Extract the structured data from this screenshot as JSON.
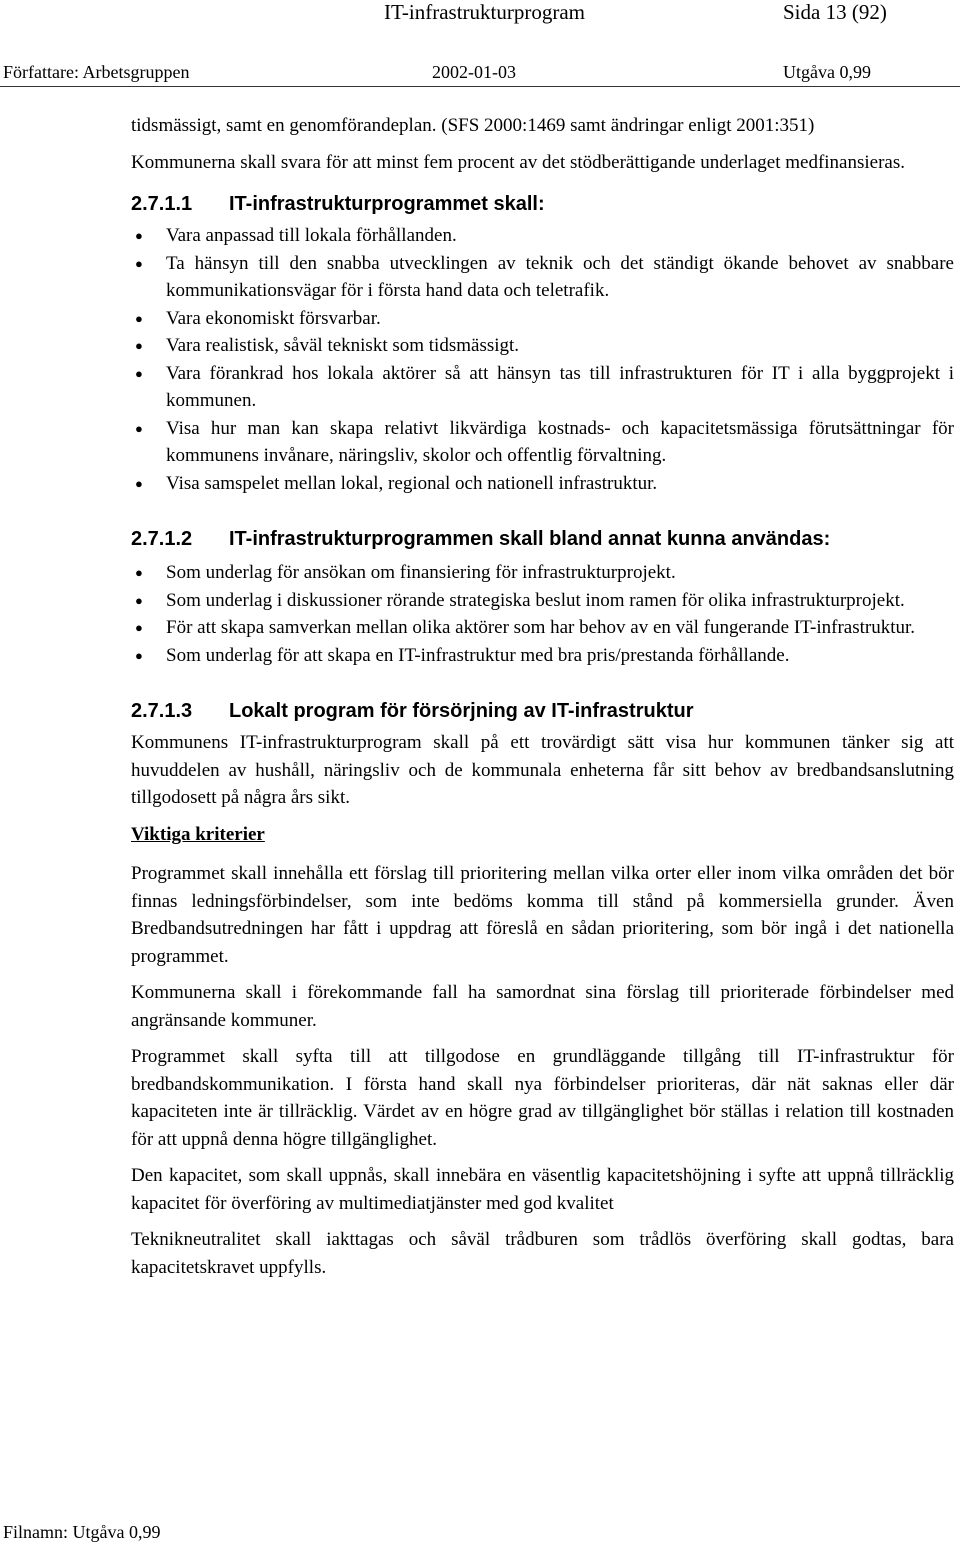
{
  "header": {
    "title": "IT-infrastrukturprogram",
    "page": "Sida 13 (92)",
    "author": "Författare: Arbetsgruppen",
    "date": "2002-01-03",
    "edition": "Utgåva 0,99"
  },
  "intro": [
    "tidsmässigt, samt en genomförandeplan. (SFS 2000:1469 samt ändringar enligt 2001:351)",
    "Kommunerna skall svara för att minst fem procent av det stödberättigande underlaget medfinansieras."
  ],
  "sections": [
    {
      "number": "2.7.1.1",
      "title": "IT-infrastrukturprogrammet skall:",
      "bullets": [
        "Vara anpassad till lokala förhållanden.",
        "Ta hänsyn till den snabba utvecklingen av teknik och det ständigt ökande behovet av snabbare kommunikationsvägar för i första hand data och teletrafik.",
        "Vara ekonomiskt försvarbar.",
        "Vara realistisk, såväl tekniskt som tidsmässigt.",
        "Vara förankrad hos lokala aktörer så att hänsyn tas till infrastrukturen för IT i alla byggprojekt i kommunen.",
        "Visa hur man kan skapa relativt likvärdiga kostnads- och kapacitetsmässiga förutsättningar för kommunens invånare, näringsliv, skolor och offentlig förvaltning.",
        "Visa samspelet mellan lokal, regional och nationell infrastruktur."
      ]
    },
    {
      "number": "2.7.1.2",
      "title": "IT-infrastrukturprogrammen skall bland annat kunna användas:",
      "bullets": [
        "Som underlag för ansökan om finansiering för infrastrukturprojekt.",
        "Som underlag i diskussioner rörande strategiska beslut inom ramen för olika infrastrukturprojekt.",
        "För att skapa samverkan mellan olika aktörer som har behov av en väl fungerande IT-infrastruktur.",
        "Som underlag för att skapa en IT-infrastruktur med bra pris/prestanda förhållande."
      ]
    },
    {
      "number": "2.7.1.3",
      "title": "Lokalt program för försörjning av IT-infrastruktur",
      "paragraph": "Kommunens IT-infrastrukturprogram skall på ett trovärdigt sätt visa hur kommunen tänker sig att huvuddelen av hushåll, näringsliv och de kommunala enheterna får sitt behov av bredbandsanslutning tillgodosett på några års sikt.",
      "subheading": "Viktiga kriterier",
      "paragraphs": [
        "Programmet skall innehålla ett förslag till prioritering mellan vilka orter eller inom vilka områden det bör finnas ledningsförbindelser, som inte bedöms komma till stånd på kommersiella grunder. Även Bredbandsutredningen har fått i uppdrag att föreslå en sådan prioritering, som bör ingå i det nationella programmet.",
        "Kommunerna skall i förekommande fall ha samordnat sina förslag till prioriterade förbindelser med angränsande kommuner.",
        "Programmet skall syfta till att tillgodose en grundläggande tillgång till IT-infrastruktur för bredbandskommunikation. I första hand skall nya förbindelser prioriteras, där nät saknas eller där kapaciteten inte är tillräcklig. Värdet av en högre grad av tillgänglighet bör ställas i relation till kostnaden för att uppnå denna högre tillgänglighet.",
        "Den kapacitet, som skall uppnås, skall innebära en väsentlig kapacitetshöjning i syfte att uppnå tillräcklig kapacitet för överföring av multimediatjänster med god kvalitet",
        "Teknikneutralitet skall iakttagas och såväl trådburen som trådlös överföring skall godtas, bara kapacitetskravet uppfylls."
      ]
    }
  ],
  "footer": {
    "filename": "Filnamn: Utgåva 0,99"
  },
  "bullet_glyph": "●"
}
